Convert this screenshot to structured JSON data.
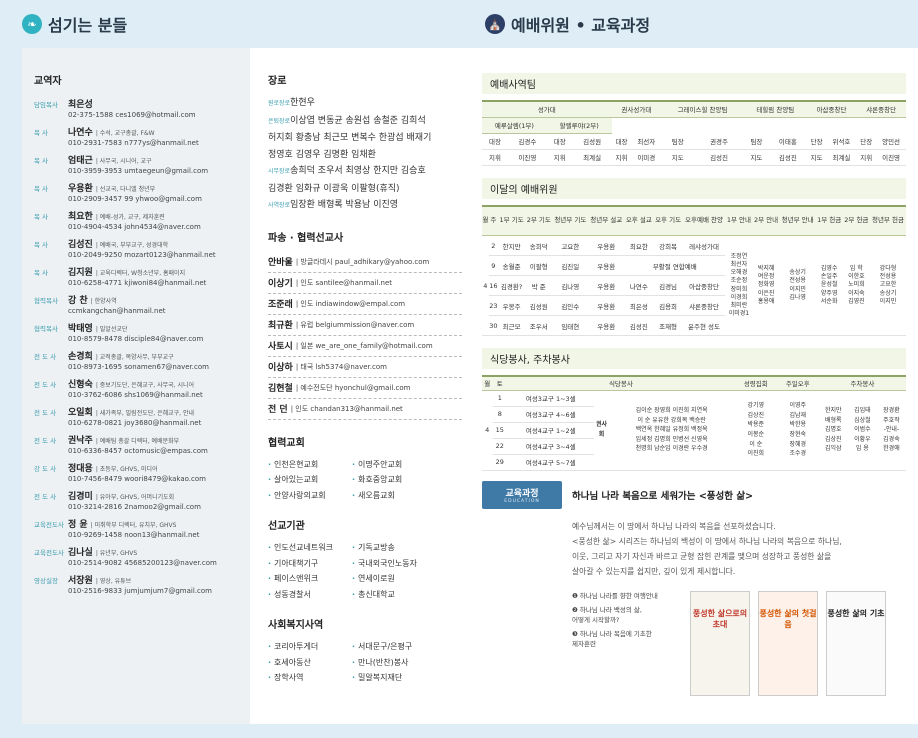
{
  "headers": {
    "left": "섬기는 분들",
    "right": "예배위원 • 교육과정"
  },
  "staff": {
    "title": "교역자",
    "people": [
      {
        "role": "담임목사",
        "name": "최은성",
        "detail": "",
        "contact": "02-375-1588  ces1069@hotmail.com"
      },
      {
        "role": "목    사",
        "name": "나연수",
        "detail": "수석, 교구총괄, F&W",
        "contact": "010-2931-7583  n777ys@hanmail.net"
      },
      {
        "role": "목    사",
        "name": "엄태근",
        "detail": "사무국, 시니어, 교구",
        "contact": "010-3959-3953  umtaegeun@gmail.com"
      },
      {
        "role": "목    사",
        "name": "우용환",
        "detail": "선교국, 다니엘 청년부",
        "contact": "010-2909-3457 99  yhwoo@gmail.com"
      },
      {
        "role": "목    사",
        "name": "최요한",
        "detail": "예배-성가, 교구, 제자훈련",
        "contact": "010-4904-4534  john4534@naver.com"
      },
      {
        "role": "목    사",
        "name": "김성진",
        "detail": "예배국, 부부교구, 성경대학",
        "contact": "010-2049-9250  mozart0123@hanmail.net"
      },
      {
        "role": "목    사",
        "name": "김지원",
        "detail": "교육디렉터, W청소년부, 홈패이지",
        "contact": "010-6258-4771  kjiwoni84@hanmail.net"
      },
      {
        "role": "협력목사",
        "name": "강  찬",
        "detail": "한양사역",
        "contact": "ccmkangchan@hanmail.net"
      },
      {
        "role": "협력목사",
        "name": "박태영",
        "detail": "밀알선교단",
        "contact": "010-8579-8478  disciple84@naver.com"
      },
      {
        "role": "전 도 사",
        "name": "손경희",
        "detail": "교적총괄, 목양사무, 부부교구",
        "contact": "010-8973-1695  sonamen67@naver.com"
      },
      {
        "role": "전 도 사",
        "name": "신형숙",
        "detail": "중보기도단, 은혜교구, 사무국, 시니어",
        "contact": "010-3762-6086  shs1069@hanmail.net"
      },
      {
        "role": "전 도 사",
        "name": "오일회",
        "detail": "새가족부, 밀림전도단, 은혜교구, 안내",
        "contact": "010-6278-0821  joy3680@hanmail.net"
      },
      {
        "role": "전 도 사",
        "name": "권낙주",
        "detail": "예배팀 총괄 디렉터, 예배문화부",
        "contact": "010-6336-8457  octomusic@empas.com"
      },
      {
        "role": "강 도 사",
        "name": "정대용",
        "detail": "초등부, GHVS, 미디어",
        "contact": "010-7456-8479  woori8479@kakao.com"
      },
      {
        "role": "전 도 사",
        "name": "김경미",
        "detail": "유아부, GHVS, 어머니기도회",
        "contact": "010-3214-2816  2namoo2@gmail.com"
      },
      {
        "role": "교육전도사",
        "name": "정  윤",
        "detail": "미취학부 디렉터, 유치부, GHVS",
        "contact": "010-9269-1458  noon13@hanmail.net"
      },
      {
        "role": "교육전도사",
        "name": "김나실",
        "detail": "유년부, GHVS",
        "contact": "010-2514-9082  45685200123@naver.com"
      },
      {
        "role": "영상실장",
        "name": "서장원",
        "detail": "영상, 유튜브",
        "contact": "010-2516-9833  jumjumjum7@gmail.com"
      }
    ]
  },
  "elders": {
    "title": "장로",
    "rows": [
      {
        "tag": "원로장로",
        "names": "한현우"
      },
      {
        "tag": "은퇴장로",
        "names": "이상엽 변동균 송원섭 송철준 김희석"
      },
      {
        "tag": "",
        "names": "허지회 황충남 최근모 변복수 한광섭 배재기"
      },
      {
        "tag": "",
        "names": "정영호 김영우 김명환 임채환"
      },
      {
        "tag": "시무장로",
        "names": "송희덕 조우서 최영상 한지만 김승호"
      },
      {
        "tag": "",
        "names": "김경환 임화규 이광욱 이팔형(휴직)"
      },
      {
        "tag": "사역장로",
        "names": "임장환 배형록 박용남 이진영"
      }
    ]
  },
  "missionaries": {
    "title": "파송 · 협력선교사",
    "list": [
      {
        "name": "안바울",
        "info": "방글라데시  paul_adhikary@yahoo.com"
      },
      {
        "name": "이상기",
        "info": "인도  santilee@hanmail.net"
      },
      {
        "name": "조준래",
        "info": "인도  indiawindow@empal.com"
      },
      {
        "name": "최규환",
        "info": "유럽  belgiummission@naver.com"
      },
      {
        "name": "사토시",
        "info": "일본  we_are_one_family@hotmail.com"
      },
      {
        "name": "이상하",
        "info": "태국  lsh5374@naver.com"
      },
      {
        "name": "김현철",
        "info": "예수전도단  hyonchul@gmail.com"
      },
      {
        "name": "전  던",
        "info": "인도  chandan313@hanmail.net"
      }
    ]
  },
  "partner_churches": {
    "title": "협력교회",
    "items": [
      "인천은현교회",
      "이명주안교회",
      "살아있는교회",
      "화호중앙교회",
      "안양사랑의교회",
      "새오름교회"
    ]
  },
  "mission_orgs": {
    "title": "선교기관",
    "items": [
      "인도선교네트워크",
      "기독교방송",
      "기아대책기구",
      "국내외국인노동자",
      "페이스앤위크",
      "연세이로원",
      "성동경찰서",
      "총신대학교"
    ]
  },
  "welfare": {
    "title": "사회복지사역",
    "items": [
      "코리아투게더",
      "서대문구/은평구",
      "호세아동산",
      "만나(반찬)봉사",
      "장학사역",
      "밀알복지재단"
    ]
  },
  "worship_team": {
    "title": "예배사역팀",
    "group_headers": [
      "성가대",
      "권사성가대",
      "그레이스힐 찬양팀",
      "테힐림 찬양팀",
      "아삽중창단",
      "샤론중창단"
    ],
    "sub_headers": [
      "예루살렘(1부)",
      "할렐루야(2부)"
    ],
    "row1": [
      "대장",
      "김경수",
      "대장",
      "김성원",
      "대장",
      "최선자",
      "팀장",
      "권경주",
      "팀장",
      "이태홍",
      "단장",
      "위석호",
      "단장",
      "양민선"
    ],
    "row2": [
      "지휘",
      "이진영",
      "지휘",
      "최계실",
      "지휘",
      "이미경",
      "지도",
      "김성진",
      "지도",
      "김성진",
      "지도",
      "최계실",
      "지휘",
      "이진영"
    ]
  },
  "monthly_worship": {
    "title": "이달의 예배위원",
    "headers": [
      "월",
      "주",
      "1부 기도",
      "2부 기도",
      "청년부 기도",
      "청년부 설교",
      "오후 설교",
      "오후 기도",
      "오후예배 찬양",
      "1부 안내",
      "2부 안내",
      "청년부 안내",
      "1부 헌금",
      "2부 헌금",
      "청년부 헌금"
    ],
    "month": "4",
    "rows": [
      {
        "week": "2",
        "cells": [
          "한지만",
          "송희덕",
          "고요한",
          "우용환",
          "최요한",
          "강희복",
          "레샤성가대"
        ]
      },
      {
        "week": "9",
        "cells": [
          "송월준",
          "이팔형",
          "김진일",
          "우용환",
          "부활절 연합예배",
          "",
          ""
        ]
      },
      {
        "week": "16",
        "cells": [
          "김경환?",
          "박  준",
          "김나영",
          "우용환",
          "나연수",
          "김경님",
          "아삽중창단"
        ]
      },
      {
        "week": "23",
        "cells": [
          "우봉주",
          "김성원",
          "김인수",
          "우용환",
          "최은성",
          "김용희",
          "샤론중창단"
        ]
      },
      {
        "week": "30",
        "cells": [
          "최근모",
          "조우서",
          "임태현",
          "우용환",
          "김성진",
          "조재형",
          "윤주현 성도"
        ]
      }
    ],
    "ushers1": "조정연\n최선자\n오해경\n조순정\n장미희\n이경희\n최미란\n이미경1",
    "ushers2": "박지혜\n여운정\n정화영\n이은진\n홍용애",
    "ushers_youth": "송상기\n전성용\n이지민\n김나영",
    "offering1": "김영수\n손일주\n윤성철\n양주영\n서순화",
    "offering2": "임  학\n이한호\n노미희\n이지숙\n김영진",
    "offering_youth": "강다형\n전성용\n고요한\n송상기\n이지민"
  },
  "meal_service": {
    "title": "식당봉사, 주차봉사",
    "headers": [
      "월",
      "토",
      "식당봉사",
      "성령집회",
      "주일오후",
      "주차봉사"
    ],
    "month": "4",
    "rows": [
      {
        "day": "1",
        "group": "여성3교구 1~3셀"
      },
      {
        "day": "8",
        "group": "여성3교구 4~6셀"
      },
      {
        "day": "15",
        "group": "여성4교구 1~2셀"
      },
      {
        "day": "22",
        "group": "여성4교구 3~4셀"
      },
      {
        "day": "29",
        "group": "여성4교구 5~7셀"
      }
    ],
    "kwonsa_label": "권사회",
    "kwonsa_names": "김이순 장영희 이진희 지연옥\n이  순 유유한 강희복 백승란\n백연옥 한혜일 유정희 백정옥\n임세정 김명희 민병선 신영옥\n천명희 남순임 이경란 우수경",
    "holy_spirit": "강기영\n김상진\n박용준\n이봉순\n이  순\n이진희",
    "sunday_pm": "이영주\n김남재\n박한용\n장현숙\n장혜경\n조수경",
    "parking1": "한지만\n배형록\n김명호\n김상진\n김익삼",
    "parking2": "김임태\n심상철\n이범수\n이황우\n임  용",
    "parking3": "장경환\n주호작\n-안내-\n김경숙\n한경애"
  },
  "education": {
    "badge": "교육과정",
    "badge_sub": "EDUCATION",
    "title": "하나님 나라 복음으로 세워가는 <풍성한 삶>",
    "text": "예수님께서는 이 땅에서 하나님 나라의 복음을 선포하셨습니다.\n<풍성한 삶> 시리즈는 하나님의 백성이 이 땅에서 하나님 나라의 복음으로 하나님,\n이웃, 그리고 자기 자신과 바르고 균형 잡힌 관계를 맺으며 성장하고 풍성한 삶을\n살아갈 수 있는지를 쉽지만, 깊이 있게 제시합니다.",
    "items": [
      "❶ 하나님 나라를 향한 여행안내",
      "❷ 하나님 나라 백성의 삶,\n    어떻게 시작할까?",
      "❸ 하나님 나라 복음에 기초한\n    제자훈련"
    ],
    "books": [
      {
        "title": "풍성한 삶으로의 초대"
      },
      {
        "title": "풍성한 삶의 첫걸음"
      },
      {
        "title": "풍성한 삶의 기초"
      }
    ]
  }
}
